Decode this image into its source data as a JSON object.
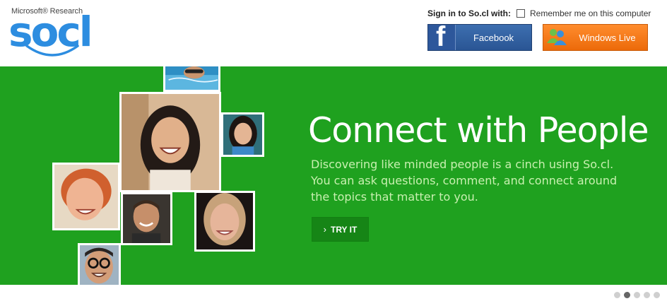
{
  "brand": {
    "company": "Microsoft® Research",
    "product": "socl",
    "accent": "#2d8de0"
  },
  "signin": {
    "label": "Sign in to So.cl with:",
    "remember_label": "Remember me on this computer",
    "remember_checked": false,
    "buttons": [
      {
        "label": "Facebook",
        "icon": "facebook-icon",
        "color": "#3b5998"
      },
      {
        "label": "Windows Live",
        "icon": "windows-live-messenger-icon",
        "color": "#f47b20"
      }
    ]
  },
  "hero": {
    "background": "#1fa11f",
    "title": "Connect with People",
    "description": "Discovering like minded people is a cinch using So.cl. You can ask questions, comment, and connect around the topics that matter to you.",
    "cta_label": "TRY IT",
    "cta_icon": "chevron-right-icon"
  },
  "carousel": {
    "slides": 5,
    "active_slide": 2
  }
}
